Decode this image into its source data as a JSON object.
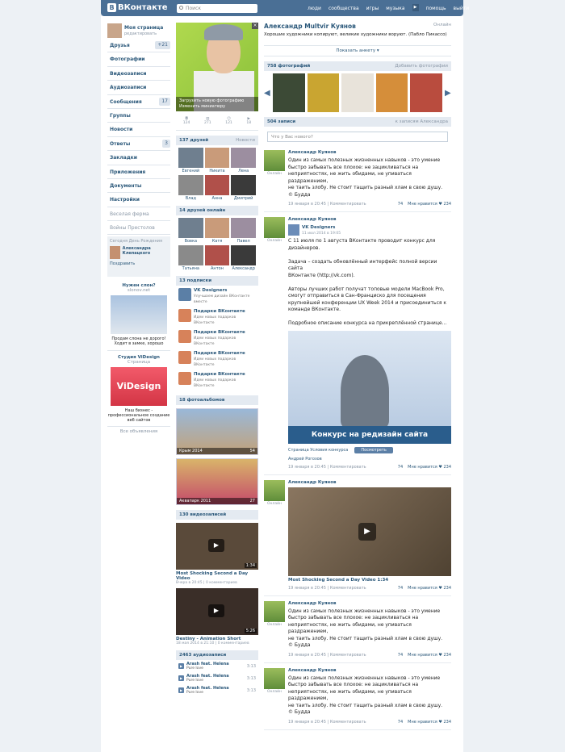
{
  "header": {
    "logo": "ВКонтакте",
    "logo_letter": "В",
    "search_placeholder": "Поиск",
    "nav": [
      "люди",
      "сообщества",
      "игры",
      "музыка",
      "помощь",
      "выйти"
    ],
    "nav_play": "▶"
  },
  "left": {
    "me": "Моя страница",
    "me_sub": "редактировать",
    "items": [
      {
        "l": "Друзья",
        "c": "+21"
      },
      {
        "l": "Фотографии",
        "c": ""
      },
      {
        "l": "Видеозаписи",
        "c": ""
      },
      {
        "l": "Аудиозаписи",
        "c": ""
      },
      {
        "l": "Сообщения",
        "c": "17"
      },
      {
        "l": "Группы",
        "c": ""
      },
      {
        "l": "Новости",
        "c": ""
      },
      {
        "l": "Ответы",
        "c": "3"
      },
      {
        "l": "Закладки",
        "c": ""
      },
      {
        "l": "Приложения",
        "c": ""
      },
      {
        "l": "Документы",
        "c": ""
      },
      {
        "l": "Настройки",
        "c": ""
      },
      {
        "l": "Веселая ферма",
        "c": ""
      },
      {
        "l": "Войны Престолов",
        "c": ""
      }
    ],
    "birth_title": "Сегодня День Рождения",
    "birth_name": "Александра Клепацкого",
    "birth_btn": "Поздравить",
    "ad1_title": "Нужен слон?",
    "ad1_url": "slonov.net",
    "ad1_text": "Продам слона не дорого! Ходит в замке, хорошо",
    "ad2_title": "Студия ViDesign",
    "ad2_sub": "Страница",
    "ad2_logo": "ViDesign",
    "ad2_text": "Наш бизнес - профессиональное создание веб сайтов",
    "ads_all": "Все объявления"
  },
  "profile_col": {
    "upload": "Загрузить новую фотографию",
    "thumb": "Изменить миниатюру",
    "counts": [
      "124",
      "271",
      "121",
      "18"
    ],
    "friends_title": "137 друзей",
    "friends_right": "Новости",
    "friends": [
      "Евгений",
      "Никита",
      "Лена",
      "Влад",
      "Анна",
      "Дмитрий"
    ],
    "online_title": "14 друзей онлайн",
    "online": [
      "Вовка",
      "Катя",
      "Павел",
      "Татьяна",
      "Антон",
      "Александр"
    ],
    "subs_title": "13 подписки",
    "subs": [
      {
        "n": "VK Designers",
        "d": "Улучшаем дизайн ВКонтакте вместе"
      },
      {
        "n": "Подарки ВКонтакте",
        "d": "Идеи новых подарков ВКонтакте"
      },
      {
        "n": "Подарки ВКонтакте",
        "d": "Идеи новых подарков ВКонтакте"
      },
      {
        "n": "Подарки ВКонтакте",
        "d": "Идеи новых подарков ВКонтакте"
      },
      {
        "n": "Подарки ВКонтакте",
        "d": "Идеи новых подарков ВКонтакте"
      }
    ],
    "albums_title": "18 фотоальбомов",
    "albums": [
      {
        "n": "Крым 2014",
        "c": "54"
      },
      {
        "n": "Аквапарк 2011",
        "c": "27"
      }
    ],
    "videos_title": "130 видеозаписей",
    "videos": [
      {
        "t": "Most Shocking Second a Day Video",
        "m": "Вчера в 20:45 | 0 комментариев",
        "d": "1:34"
      },
      {
        "t": "Destiny - Animation Short",
        "m": "18 мая 2014 в 21:10 | 0 комментариев",
        "d": "5:26"
      }
    ],
    "audio_title": "2463 аудиозаписи",
    "audio": [
      {
        "a": "Arash feat. Helena",
        "s": "Pure love",
        "d": "3:13"
      },
      {
        "a": "Arash feat. Helena",
        "s": "Pure love",
        "d": "3:13"
      },
      {
        "a": "Arash feat. Helena",
        "s": "Pure love",
        "d": "3:13"
      }
    ]
  },
  "main": {
    "name": "Александр Multvir Куянов",
    "online": "Онлайн",
    "status": "Хорошие художники копируют, великие художники воруют. (Пабло Пикассо)",
    "more": "Показать анкету ▾",
    "photos_title": "758 фотографий",
    "photos_add": "Добавить фотографии",
    "wall_title": "504 записи",
    "wall_right": "к записям Александра",
    "wall_input": "Что у Вас нового?",
    "posts": [
      {
        "au": "Александр Куянов",
        "tx": "Один из самых полезных жизненных навыков - это умение\nбыстро забывать все плохое: не зацикливаться на\nнеприятностях, не жить обидами, не упиваться раздражением,\nне таить злобу. Не стоит тащить разный хлам в свою душу.\n© Будда",
        "dt": "19 января в 20:45 | Комментировать",
        "sh": "74",
        "lk": "Мне нравится ♥ 234",
        "on": "Онлайн"
      },
      {
        "au": "Александр Куянов",
        "rep": "VK Designers",
        "rep_d": "11 июл 2014 в 19:05",
        "tx": "С 11 июля по 1 августа ВКонтакте проводит конкурс для\nдизайнеров.\n\nЗадача – создать обновлённый интерфейс полной версии сайта\nВКонтакте (http://vk.com).\n\nАвторы лучших работ получат топовые модели MacBook Pro,\nсмогут отправиться в Сан-Франциско для посещения\nкрупнейшей конференции UX Week 2014 и присоединиться к\nкоманде ВКонтакте.\n\nПодробное описание конкурса на прикреплённой странице...",
        "banner": "Конкурс на редизайн сайта",
        "page": "Страница Условия конкурса",
        "page_btn": "Посмотреть",
        "signer": "Андрей Рогозов",
        "dt": "19 января в 20:45 | Комментировать",
        "sh": "74",
        "lk": "Мне нравится ♥ 234",
        "on": "Онлайн"
      },
      {
        "au": "Александр Куянов",
        "vid": "Most Shocking Second a Day Video 1:34",
        "dt": "19 января в 20:45 | Комментировать",
        "sh": "74",
        "lk": "Мне нравится ♥ 234",
        "on": "Онлайн"
      },
      {
        "au": "Александр Куянов",
        "tx": "Один из самых полезных жизненных навыков - это умение\nбыстро забывать все плохое: не зацикливаться на\nнеприятностях, не жить обидами, не упиваться раздражением,\nне таить злобу. Не стоит тащить разный хлам в свою душу.\n© Будда",
        "dt": "19 января в 20:45 | Комментировать",
        "sh": "74",
        "lk": "Мне нравится ♥ 234",
        "on": "Онлайн"
      },
      {
        "au": "Александр Куянов",
        "tx": "Один из самых полезных жизненных навыков - это умение\nбыстро забывать все плохое: не зацикливаться на\nнеприятностях, не жить обидами, не упиваться раздражением,\nне таить злобу. Не стоит тащить разный хлам в свою душу.\n© Будда",
        "dt": "19 января в 20:45 | Комментировать",
        "sh": "74",
        "lk": "Мне нравится ♥ 234",
        "on": "Онлайн"
      }
    ]
  }
}
